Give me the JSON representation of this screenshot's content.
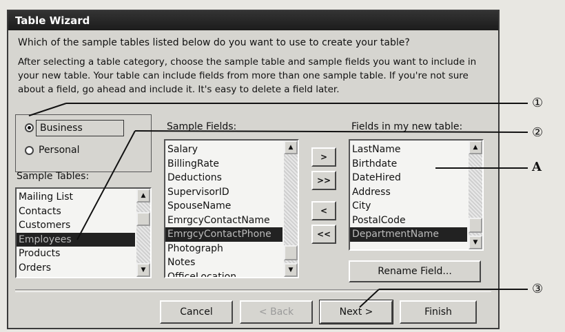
{
  "window": {
    "title": "Table Wizard"
  },
  "question": "Which of the sample tables listed below do you want to use to create your table?",
  "instructions": "After selecting a table category, choose the sample table and sample fields you want to include in your new table. Your table can include fields from more than one sample table. If you're not sure about a field, go ahead and include it. It's easy to delete a field later.",
  "category": {
    "business": "Business",
    "personal": "Personal",
    "selected": "Business"
  },
  "sample_tables": {
    "label": "Sample Tables:",
    "items": [
      "Mailing List",
      "Contacts",
      "Customers",
      "Employees",
      "Products",
      "Orders"
    ],
    "selected": "Employees"
  },
  "sample_fields": {
    "label": "Sample Fields:",
    "items": [
      "Salary",
      "BillingRate",
      "Deductions",
      "SupervisorID",
      "SpouseName",
      "EmrgcyContactName",
      "EmrgcyContactPhone",
      "Photograph",
      "Notes",
      "OfficeLocation"
    ],
    "selected": "EmrgcyContactPhone"
  },
  "new_fields": {
    "label": "Fields in my new table:",
    "items": [
      "LastName",
      "Birthdate",
      "DateHired",
      "Address",
      "City",
      "PostalCode",
      "DepartmentName"
    ],
    "selected": "DepartmentName"
  },
  "move_buttons": {
    "add_one": ">",
    "add_all": ">>",
    "remove_one": "<",
    "remove_all": "<<"
  },
  "rename_button": "Rename Field...",
  "footer": {
    "cancel": "Cancel",
    "back": "< Back",
    "next": "Next >",
    "finish": "Finish"
  },
  "annotations": {
    "a1": "①",
    "a2": "②",
    "a3": "③",
    "letter": "A"
  }
}
